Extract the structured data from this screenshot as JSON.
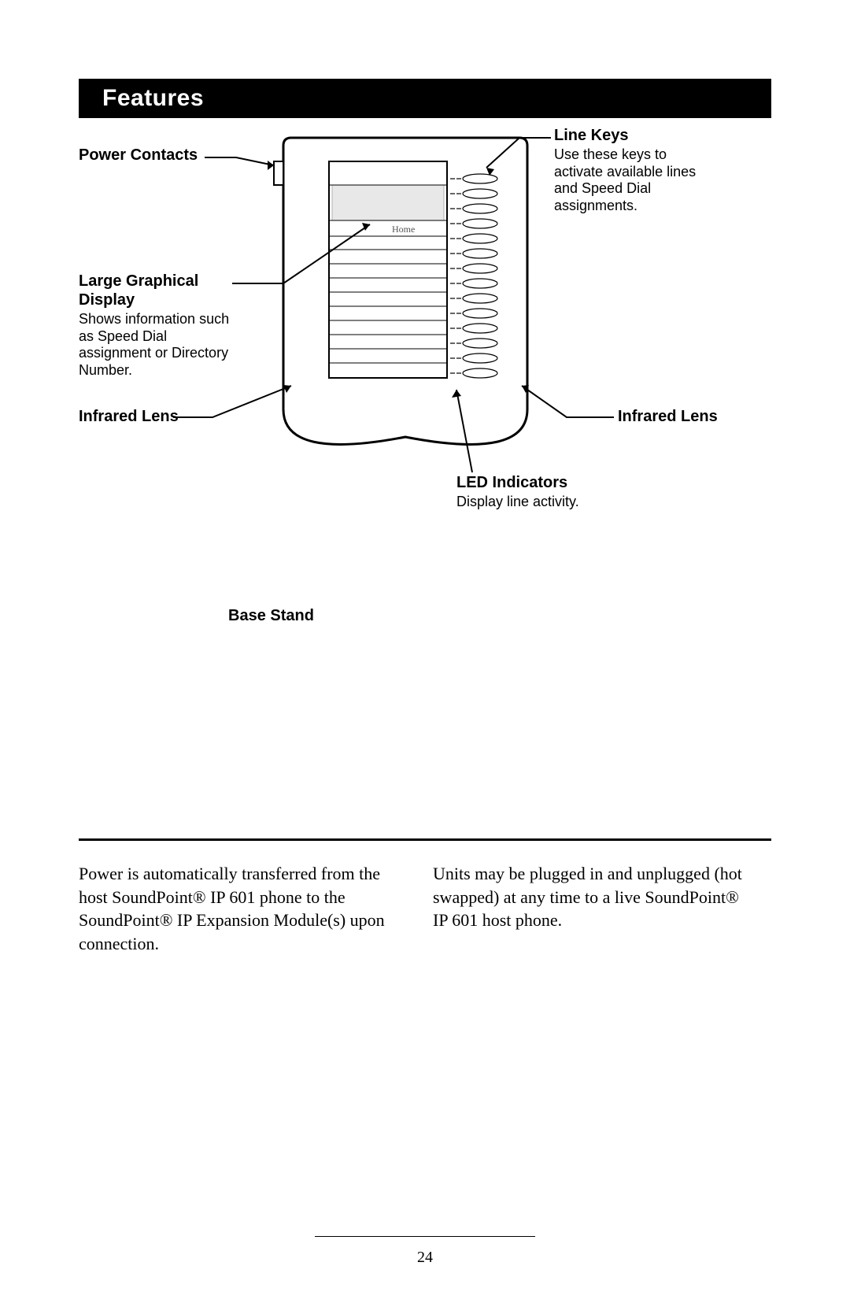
{
  "header": {
    "title": "Features"
  },
  "callouts": {
    "power_contacts": {
      "title": "Power Contacts"
    },
    "large_display": {
      "title": "Large Graphical Display",
      "desc": "Shows information such as Speed Dial assignment or Directory Number."
    },
    "infrared_left": {
      "title": "Infrared Lens"
    },
    "line_keys": {
      "title": "Line Keys",
      "desc": "Use these keys to activate available lines and Speed Dial assignments."
    },
    "infrared_right": {
      "title": "Infrared Lens"
    },
    "led_indicators": {
      "title": "LED Indicators",
      "desc": "Display line activity."
    },
    "base_stand": {
      "title": "Base Stand"
    }
  },
  "device": {
    "display_label": "Home"
  },
  "body": {
    "col1": "Power is automatically transferred from the host SoundPoint® IP 601 phone to the SoundPoint® IP Expansion Module(s) upon connection.",
    "col2": "Units may be plugged in and unplugged (hot swapped) at any time to a live Sound­Point® IP 601 host phone."
  },
  "page_number": "24"
}
